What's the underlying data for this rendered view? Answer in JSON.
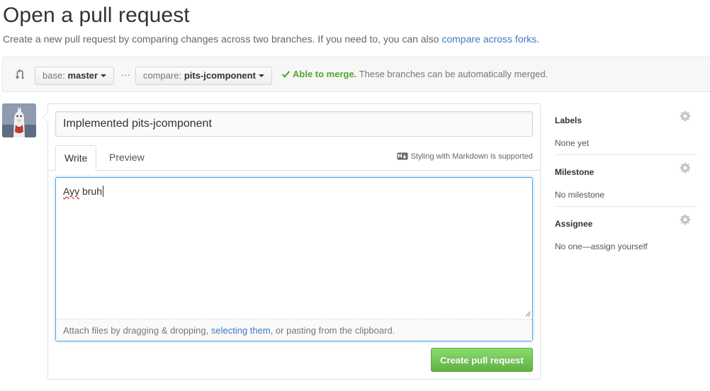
{
  "page": {
    "title": "Open a pull request",
    "subtitle": "Create a new pull request by comparing changes across two branches. If you need to, you can also",
    "subtitle_link": "compare across forks",
    "subtitle_end": "."
  },
  "range": {
    "base_prefix": "base:",
    "base_value": "master",
    "dots": "···",
    "compare_prefix": "compare:",
    "compare_value": "pits-jcomponent",
    "merge_ok": "Able to merge.",
    "merge_text": "These branches can be automatically merged."
  },
  "form": {
    "title_value": "Implemented pits-jcomponent",
    "tab_write": "Write",
    "tab_preview": "Preview",
    "markdown_hint": "Styling with Markdown is supported",
    "body_word1": "Ayy",
    "body_word2": " bruh",
    "drag_text": "Attach files by dragging & dropping,",
    "drag_link": "selecting them",
    "drag_end": ", or pasting from the clipboard.",
    "submit_label": "Create pull request"
  },
  "sidebar": {
    "labels_heading": "Labels",
    "labels_value": "None yet",
    "milestone_heading": "Milestone",
    "milestone_value": "No milestone",
    "assignee_heading": "Assignee",
    "assignee_value": "No one—assign yourself"
  },
  "colors": {
    "accent_link": "#4078c0",
    "merge_ok": "#55a532",
    "submit_green": "#6cc644",
    "focus_blue": "#51a7e8"
  },
  "icons": {
    "range": "git-compare-icon",
    "merge": "check-icon",
    "markdown": "markdown-icon",
    "settings": "gear-icon"
  }
}
